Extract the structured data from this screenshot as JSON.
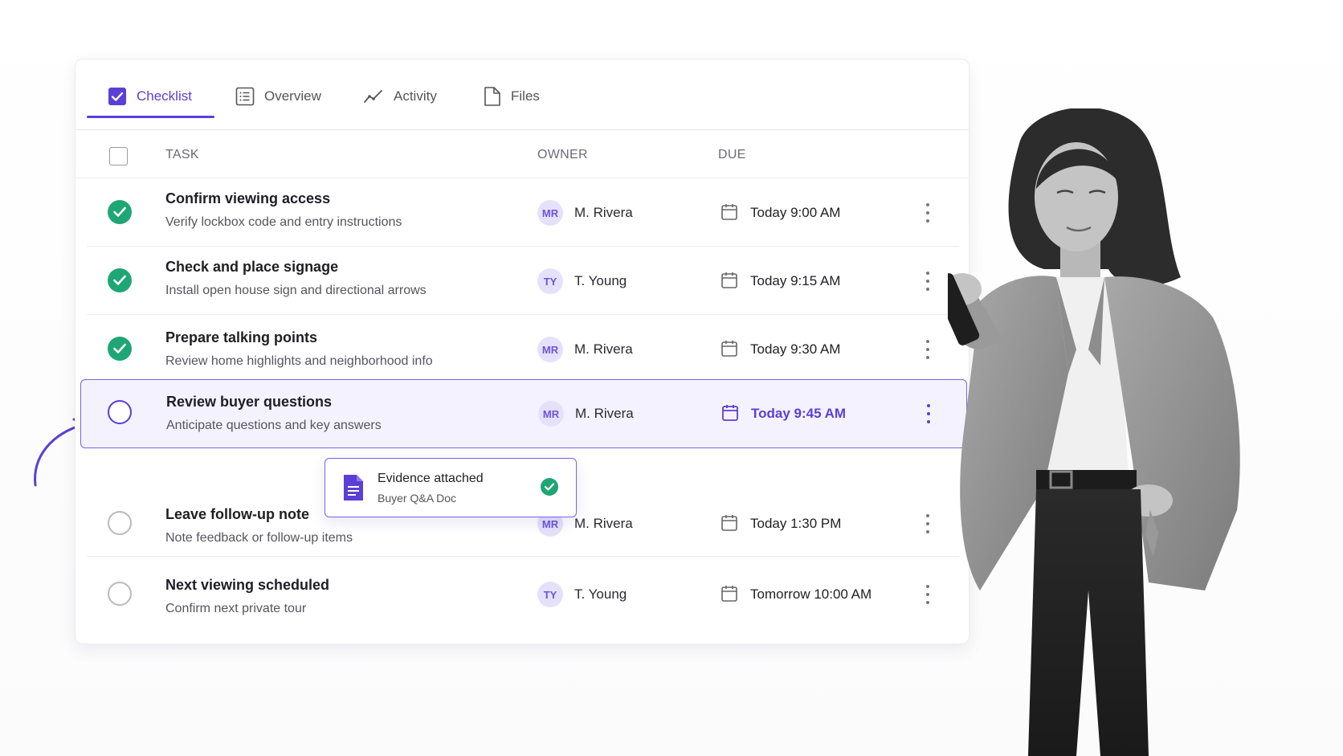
{
  "tabs": [
    {
      "label": "Checklist",
      "icon": "checkbox-icon",
      "active": true
    },
    {
      "label": "Overview",
      "icon": "list-icon",
      "active": false
    },
    {
      "label": "Activity",
      "icon": "activity-icon",
      "active": false
    },
    {
      "label": "Files",
      "icon": "file-icon",
      "active": false
    }
  ],
  "table": {
    "headers": {
      "task": "TASK",
      "owner": "OWNER",
      "due": "DUE"
    }
  },
  "tasks": [
    {
      "title": "Confirm viewing access",
      "subtitle": "Verify lockbox code and entry instructions",
      "owner_initials": "MR",
      "owner": "M. Rivera",
      "due": "Today 9:00 AM",
      "status": "done"
    },
    {
      "title": "Check and place signage",
      "subtitle": "Install open house sign and directional arrows",
      "owner_initials": "TY",
      "owner": "T. Young",
      "due": "Today 9:15 AM",
      "status": "done"
    },
    {
      "title": "Prepare talking points",
      "subtitle": "Review home highlights and neighborhood info",
      "owner_initials": "MR",
      "owner": "M. Rivera",
      "due": "Today 9:30 AM",
      "status": "done"
    },
    {
      "title": "Review buyer questions",
      "subtitle": "Anticipate questions and key answers",
      "owner_initials": "MR",
      "owner": "M. Rivera",
      "due": "Today 9:45 AM",
      "status": "active"
    },
    {
      "title": "Leave follow-up note",
      "subtitle": "Note feedback or follow-up items",
      "owner_initials": "MR",
      "owner": "M. Rivera",
      "due": "Today 1:30 PM",
      "status": "todo"
    },
    {
      "title": "Next viewing scheduled",
      "subtitle": "Confirm next private tour",
      "owner_initials": "TY",
      "owner": "T. Young",
      "due": "Tomorrow 10:00 AM",
      "status": "todo"
    }
  ],
  "evidence": {
    "title": "Evidence attached",
    "subtitle": "Buyer Q&A Doc"
  },
  "colors": {
    "accent": "#5b3fd6",
    "done": "#1fa675",
    "highlight_bg": "#f4f2ff"
  }
}
